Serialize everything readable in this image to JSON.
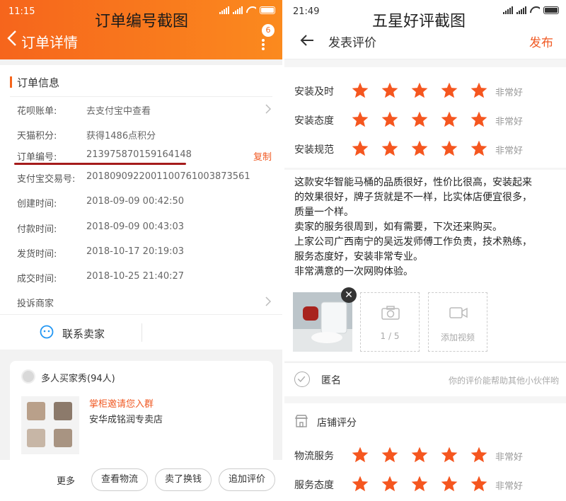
{
  "left": {
    "overlay_title": "订单编号截图",
    "status": {
      "time": "11:15"
    },
    "header": {
      "title": "订单详情",
      "badge": "6"
    },
    "section_title": "订单信息",
    "rows": [
      {
        "label": "花呗账单:",
        "value": "去支付宝中查看"
      },
      {
        "label": "天猫积分:",
        "value": "获得1486点积分"
      },
      {
        "label": "订单编号:",
        "value": "213975870159164148",
        "action": "复制"
      },
      {
        "label": "支付宝交易号:",
        "value": "2018090922001100761003873561"
      },
      {
        "label": "创建时间:",
        "value": "2018-09-09 00:42:50"
      },
      {
        "label": "付款时间:",
        "value": "2018-09-09 00:43:03"
      },
      {
        "label": "发货时间:",
        "value": "2018-10-17 20:19:03"
      },
      {
        "label": "成交时间:",
        "value": "2018-10-25 21:40:27"
      },
      {
        "label": "投诉商家",
        "value": ""
      }
    ],
    "contact": "联系卖家",
    "buyer_show": {
      "title": "多人买家秀(94人)",
      "invite": "掌柜邀请您入群",
      "shop": "安华成铭润专卖店"
    },
    "actions": {
      "more": "更多",
      "logistics": "查看物流",
      "resell": "卖了换钱",
      "append_review": "追加评价"
    }
  },
  "right": {
    "overlay_title": "五星好评截图",
    "status": {
      "time": "21:49"
    },
    "header": {
      "title": "发表评价",
      "publish": "发布"
    },
    "ratings": [
      {
        "label": "安装及时",
        "stars": 5,
        "text": "非常好"
      },
      {
        "label": "安装态度",
        "stars": 5,
        "text": "非常好"
      },
      {
        "label": "安装规范",
        "stars": 5,
        "text": "非常好"
      }
    ],
    "review_lines": [
      "这款安华智能马桶的品质很好，性价比很高，安装起来",
      "的效果很好，牌子货就是不一样，比实体店便宜很多，",
      "质量一个样。",
      "卖家的服务很周到，如有需要，下次还来购买。",
      "上家公司广西南宁的吴远发师傅工作负责，技术熟练，",
      "服务态度好，安装非常专业。",
      "非常满意的一次网购体验。"
    ],
    "upload": {
      "photo_count": "1 / 5",
      "add_video": "添加视频"
    },
    "anonymous": {
      "label": "匿名",
      "hint": "你的评价能帮助其他小伙伴哟"
    },
    "shop_rating": {
      "title": "店铺评分",
      "items": [
        {
          "label": "物流服务",
          "stars": 5,
          "text": "非常好"
        },
        {
          "label": "服务态度",
          "stars": 5,
          "text": "非常好"
        }
      ]
    },
    "colors": {
      "star": "#f5561f",
      "accent": "#f05a24"
    }
  }
}
